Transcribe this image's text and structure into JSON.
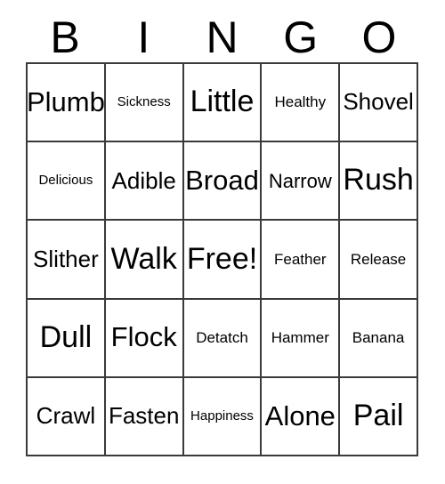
{
  "card": {
    "title": "BINGO",
    "header_letters": [
      "B",
      "I",
      "N",
      "G",
      "O"
    ],
    "columns": 5,
    "rows": 5,
    "border_color": "#3a3a3a",
    "background_color": "#ffffff",
    "text_color": "#000000",
    "free_space": "Free!",
    "free_space_position": "center",
    "grid": [
      [
        {
          "label": "Plumb",
          "size": "lg"
        },
        {
          "label": "Sickness",
          "size": "xxs"
        },
        {
          "label": "Little",
          "size": "xl"
        },
        {
          "label": "Healthy",
          "size": "xs"
        },
        {
          "label": "Shovel",
          "size": "md"
        }
      ],
      [
        {
          "label": "Delicious",
          "size": "xxs"
        },
        {
          "label": "Adible",
          "size": "md"
        },
        {
          "label": "Broad",
          "size": "lg"
        },
        {
          "label": "Narrow",
          "size": "sm"
        },
        {
          "label": "Rush",
          "size": "xl"
        }
      ],
      [
        {
          "label": "Slither",
          "size": "md"
        },
        {
          "label": "Walk",
          "size": "xl"
        },
        {
          "label": "Free!",
          "size": "xl"
        },
        {
          "label": "Feather",
          "size": "xs"
        },
        {
          "label": "Release",
          "size": "xs"
        }
      ],
      [
        {
          "label": "Dull",
          "size": "xl"
        },
        {
          "label": "Flock",
          "size": "lg"
        },
        {
          "label": "Detatch",
          "size": "xs"
        },
        {
          "label": "Hammer",
          "size": "xs"
        },
        {
          "label": "Banana",
          "size": "xs"
        }
      ],
      [
        {
          "label": "Crawl",
          "size": "md"
        },
        {
          "label": "Fasten",
          "size": "md"
        },
        {
          "label": "Happiness",
          "size": "xxs"
        },
        {
          "label": "Alone",
          "size": "lg"
        },
        {
          "label": "Pail",
          "size": "xl"
        }
      ]
    ]
  }
}
